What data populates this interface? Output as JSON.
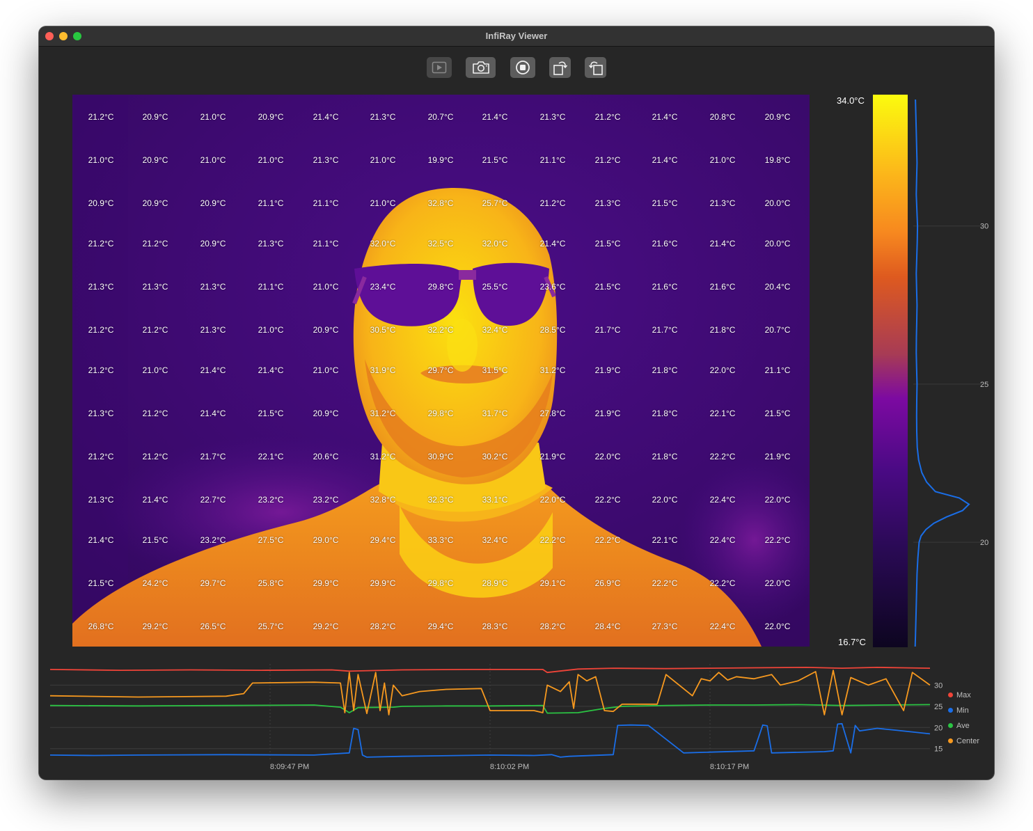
{
  "window": {
    "title": "InfiRay Viewer"
  },
  "toolbar": {
    "buttons": [
      {
        "icon": "play-icon",
        "enabled": false
      },
      {
        "icon": "camera-icon",
        "enabled": true
      },
      {
        "icon": "record-stop-icon",
        "enabled": true
      },
      {
        "icon": "rotate-right-icon",
        "enabled": true
      },
      {
        "icon": "rotate-left-icon",
        "enabled": true
      }
    ]
  },
  "thermal_grid": [
    [
      "21.2°C",
      "20.9°C",
      "21.0°C",
      "20.9°C",
      "21.4°C",
      "21.3°C",
      "20.7°C",
      "21.4°C",
      "21.3°C",
      "21.2°C",
      "21.4°C",
      "20.8°C",
      "20.9°C"
    ],
    [
      "21.0°C",
      "20.9°C",
      "21.0°C",
      "21.0°C",
      "21.3°C",
      "21.0°C",
      "19.9°C",
      "21.5°C",
      "21.1°C",
      "21.2°C",
      "21.4°C",
      "21.0°C",
      "19.8°C"
    ],
    [
      "20.9°C",
      "20.9°C",
      "20.9°C",
      "21.1°C",
      "21.1°C",
      "21.0°C",
      "32.8°C",
      "25.7°C",
      "21.2°C",
      "21.3°C",
      "21.5°C",
      "21.3°C",
      "20.0°C"
    ],
    [
      "21.2°C",
      "21.2°C",
      "20.9°C",
      "21.3°C",
      "21.1°C",
      "32.0°C",
      "32.5°C",
      "32.0°C",
      "21.4°C",
      "21.5°C",
      "21.6°C",
      "21.4°C",
      "20.0°C"
    ],
    [
      "21.3°C",
      "21.3°C",
      "21.3°C",
      "21.1°C",
      "21.0°C",
      "23.4°C",
      "29.8°C",
      "25.5°C",
      "23.6°C",
      "21.5°C",
      "21.6°C",
      "21.6°C",
      "20.4°C"
    ],
    [
      "21.2°C",
      "21.2°C",
      "21.3°C",
      "21.0°C",
      "20.9°C",
      "30.5°C",
      "32.2°C",
      "32.4°C",
      "28.5°C",
      "21.7°C",
      "21.7°C",
      "21.8°C",
      "20.7°C"
    ],
    [
      "21.2°C",
      "21.0°C",
      "21.4°C",
      "21.4°C",
      "21.0°C",
      "31.9°C",
      "29.7°C",
      "31.5°C",
      "31.2°C",
      "21.9°C",
      "21.8°C",
      "22.0°C",
      "21.1°C"
    ],
    [
      "21.3°C",
      "21.2°C",
      "21.4°C",
      "21.5°C",
      "20.9°C",
      "31.2°C",
      "29.8°C",
      "31.7°C",
      "27.8°C",
      "21.9°C",
      "21.8°C",
      "22.1°C",
      "21.5°C"
    ],
    [
      "21.2°C",
      "21.2°C",
      "21.7°C",
      "22.1°C",
      "20.6°C",
      "31.2°C",
      "30.9°C",
      "30.2°C",
      "21.9°C",
      "22.0°C",
      "21.8°C",
      "22.2°C",
      "21.9°C"
    ],
    [
      "21.3°C",
      "21.4°C",
      "22.7°C",
      "23.2°C",
      "23.2°C",
      "32.8°C",
      "32.3°C",
      "33.1°C",
      "22.0°C",
      "22.2°C",
      "22.0°C",
      "22.4°C",
      "22.0°C"
    ],
    [
      "21.4°C",
      "21.5°C",
      "23.2°C",
      "27.5°C",
      "29.0°C",
      "29.4°C",
      "33.3°C",
      "32.4°C",
      "22.2°C",
      "22.2°C",
      "22.1°C",
      "22.4°C",
      "22.2°C"
    ],
    [
      "21.5°C",
      "24.2°C",
      "29.7°C",
      "25.8°C",
      "29.9°C",
      "29.9°C",
      "29.8°C",
      "28.9°C",
      "29.1°C",
      "26.9°C",
      "22.2°C",
      "22.2°C",
      "22.0°C"
    ],
    [
      "26.8°C",
      "29.2°C",
      "26.5°C",
      "25.7°C",
      "29.2°C",
      "28.2°C",
      "29.4°C",
      "28.3°C",
      "28.2°C",
      "28.4°C",
      "27.3°C",
      "22.4°C",
      "22.0°C"
    ]
  ],
  "color_scale": {
    "max_label": "34.0°C",
    "min_label": "16.7°C",
    "max": 34.0,
    "min": 16.7
  },
  "chart_data": [
    {
      "type": "line",
      "title": "",
      "ylim": [
        16.7,
        34.0
      ],
      "y_ticks": [
        "30",
        "25",
        "20"
      ],
      "y_tick_values": [
        30,
        25,
        20
      ],
      "series": [
        {
          "color": "#1a6ee8",
          "x": [
            34.0,
            33.0,
            32.0,
            31.5,
            31.0,
            30.5,
            30.0,
            29.5,
            29.0,
            28.5,
            28.0,
            27.5,
            27.0,
            26.5,
            26.0,
            25.5,
            25.0,
            24.5,
            24.0,
            23.5,
            23.0,
            22.6,
            22.2,
            21.9,
            21.6,
            21.4,
            21.2,
            21.0,
            20.8,
            20.6,
            20.4,
            20.2,
            20.0,
            19.5,
            19.0,
            18.0,
            17.0,
            16.7
          ],
          "values": [
            0.5,
            1.0,
            1.5,
            1.2,
            1.0,
            1.4,
            1.8,
            1.6,
            1.3,
            1.0,
            1.2,
            1.5,
            1.3,
            1.1,
            1.0,
            1.2,
            1.5,
            1.3,
            1.2,
            1.3,
            1.6,
            2.5,
            4.5,
            7.5,
            13.0,
            28.0,
            34.0,
            30.0,
            20.0,
            12.0,
            7.0,
            4.0,
            2.8,
            2.0,
            1.5,
            1.0,
            0.5,
            0.3
          ]
        }
      ]
    },
    {
      "type": "line",
      "title": "",
      "ylim": [
        12,
        35
      ],
      "y_ticks": [
        "30",
        "25",
        "20",
        "15"
      ],
      "y_tick_values": [
        30,
        25,
        20,
        15
      ],
      "x_ticks": [
        "8:09:47 PM",
        "8:10:02 PM",
        "8:10:17 PM"
      ],
      "legend_position": "right",
      "series": [
        {
          "name": "Max",
          "color": "#f04438",
          "x": [
            0,
            0.08,
            0.16,
            0.24,
            0.32,
            0.34,
            0.4,
            0.48,
            0.56,
            0.565,
            0.6,
            0.64,
            0.7,
            0.75,
            0.8,
            0.86,
            0.9,
            0.94,
            0.97,
            1.0
          ],
          "values": [
            33.7,
            33.5,
            33.6,
            33.5,
            33.6,
            33.3,
            33.6,
            33.7,
            33.7,
            33.0,
            33.8,
            34.0,
            33.9,
            34.0,
            34.1,
            34.2,
            34.0,
            34.2,
            34.1,
            34.0
          ]
        },
        {
          "name": "Min",
          "color": "#1a6ee8",
          "x": [
            0,
            0.05,
            0.1,
            0.2,
            0.3,
            0.34,
            0.345,
            0.35,
            0.355,
            0.36,
            0.4,
            0.5,
            0.55,
            0.57,
            0.58,
            0.59,
            0.64,
            0.645,
            0.66,
            0.68,
            0.72,
            0.8,
            0.81,
            0.815,
            0.82,
            0.88,
            0.89,
            0.895,
            0.9,
            0.91,
            0.915,
            0.92,
            0.94,
            0.96,
            1.0
          ],
          "values": [
            13.5,
            13.4,
            13.5,
            13.6,
            13.5,
            14.0,
            19.8,
            19.5,
            13.5,
            13.0,
            13.2,
            13.5,
            13.4,
            13.6,
            13.0,
            13.2,
            13.6,
            20.5,
            20.6,
            20.5,
            14.0,
            14.5,
            20.6,
            20.4,
            14.0,
            14.3,
            14.5,
            20.8,
            20.9,
            14.0,
            20.5,
            19.2,
            19.8,
            19.4,
            18.5
          ]
        },
        {
          "name": "Ave",
          "color": "#2bc443",
          "x": [
            0,
            0.1,
            0.2,
            0.3,
            0.33,
            0.34,
            0.35,
            0.39,
            0.4,
            0.45,
            0.5,
            0.56,
            0.565,
            0.6,
            0.63,
            0.65,
            0.7,
            0.75,
            0.8,
            0.85,
            0.9,
            0.95,
            1.0
          ],
          "values": [
            25.2,
            25.1,
            25.2,
            25.3,
            24.8,
            23.5,
            24.7,
            24.8,
            25.0,
            25.1,
            25.1,
            25.2,
            23.4,
            23.5,
            24.5,
            25.0,
            25.2,
            25.3,
            25.3,
            25.4,
            25.2,
            25.3,
            25.4
          ]
        },
        {
          "name": "Center",
          "color": "#f7991f",
          "x": [
            0,
            0.1,
            0.2,
            0.22,
            0.23,
            0.3,
            0.33,
            0.335,
            0.34,
            0.345,
            0.35,
            0.36,
            0.37,
            0.375,
            0.38,
            0.385,
            0.39,
            0.4,
            0.42,
            0.45,
            0.49,
            0.5,
            0.55,
            0.56,
            0.565,
            0.58,
            0.59,
            0.595,
            0.6,
            0.61,
            0.62,
            0.63,
            0.64,
            0.65,
            0.69,
            0.7,
            0.73,
            0.74,
            0.75,
            0.76,
            0.77,
            0.78,
            0.8,
            0.82,
            0.83,
            0.85,
            0.87,
            0.88,
            0.89,
            0.9,
            0.91,
            0.93,
            0.95,
            0.97,
            0.98,
            1.0
          ],
          "values": [
            27.5,
            27.2,
            27.4,
            28.0,
            30.5,
            30.7,
            30.5,
            23.5,
            33.0,
            24.0,
            32.5,
            23.3,
            33.0,
            24.0,
            30.5,
            23.0,
            30.0,
            27.5,
            28.5,
            29.0,
            29.2,
            24.0,
            24.0,
            23.5,
            30.0,
            28.5,
            30.8,
            24.5,
            32.5,
            31.0,
            32.0,
            24.0,
            23.8,
            25.5,
            25.5,
            32.5,
            27.5,
            31.5,
            31.0,
            33.0,
            31.2,
            32.0,
            31.5,
            32.5,
            30.0,
            31.0,
            33.2,
            23.0,
            33.5,
            23.0,
            31.8,
            30.0,
            31.5,
            24.0,
            33.0,
            30.0
          ]
        }
      ]
    }
  ]
}
